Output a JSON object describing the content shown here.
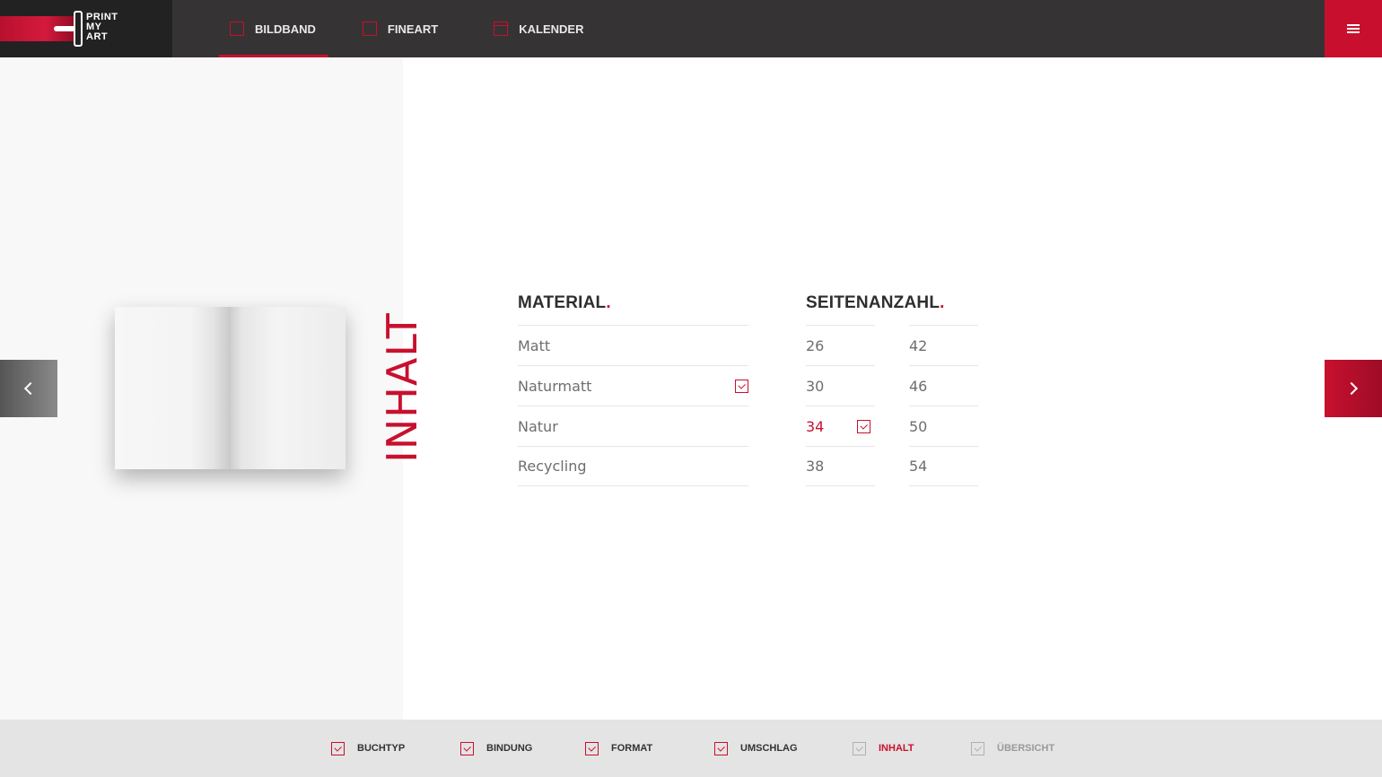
{
  "header": {
    "logo_lines": [
      "PRINT",
      "MY",
      "ART"
    ],
    "nav": [
      {
        "label": "BILDBAND",
        "active": true
      },
      {
        "label": "FINEART",
        "active": false
      },
      {
        "label": "KALENDER",
        "active": false
      }
    ]
  },
  "preview": {
    "vertical_title": "INHALT"
  },
  "material": {
    "title": "MATERIAL",
    "options": [
      "Matt",
      "Naturmatt",
      "Natur",
      "Recycling"
    ],
    "selected": "Naturmatt"
  },
  "pages": {
    "title": "SEITENANZAHL",
    "col_a": [
      "26",
      "30",
      "34",
      "38"
    ],
    "col_b": [
      "42",
      "46",
      "50",
      "54"
    ],
    "selected": "34"
  },
  "steps": [
    {
      "label": "BUCHTYP",
      "state": "done"
    },
    {
      "label": "BINDUNG",
      "state": "done"
    },
    {
      "label": "FORMAT",
      "state": "done"
    },
    {
      "label": "UMSCHLAG",
      "state": "done"
    },
    {
      "label": "INHALT",
      "state": "current"
    },
    {
      "label": "ÜBERSICHT",
      "state": "future"
    }
  ],
  "colors": {
    "accent": "#c8102e",
    "header_bg": "#363334",
    "steps_bg": "#e4e4e4"
  }
}
